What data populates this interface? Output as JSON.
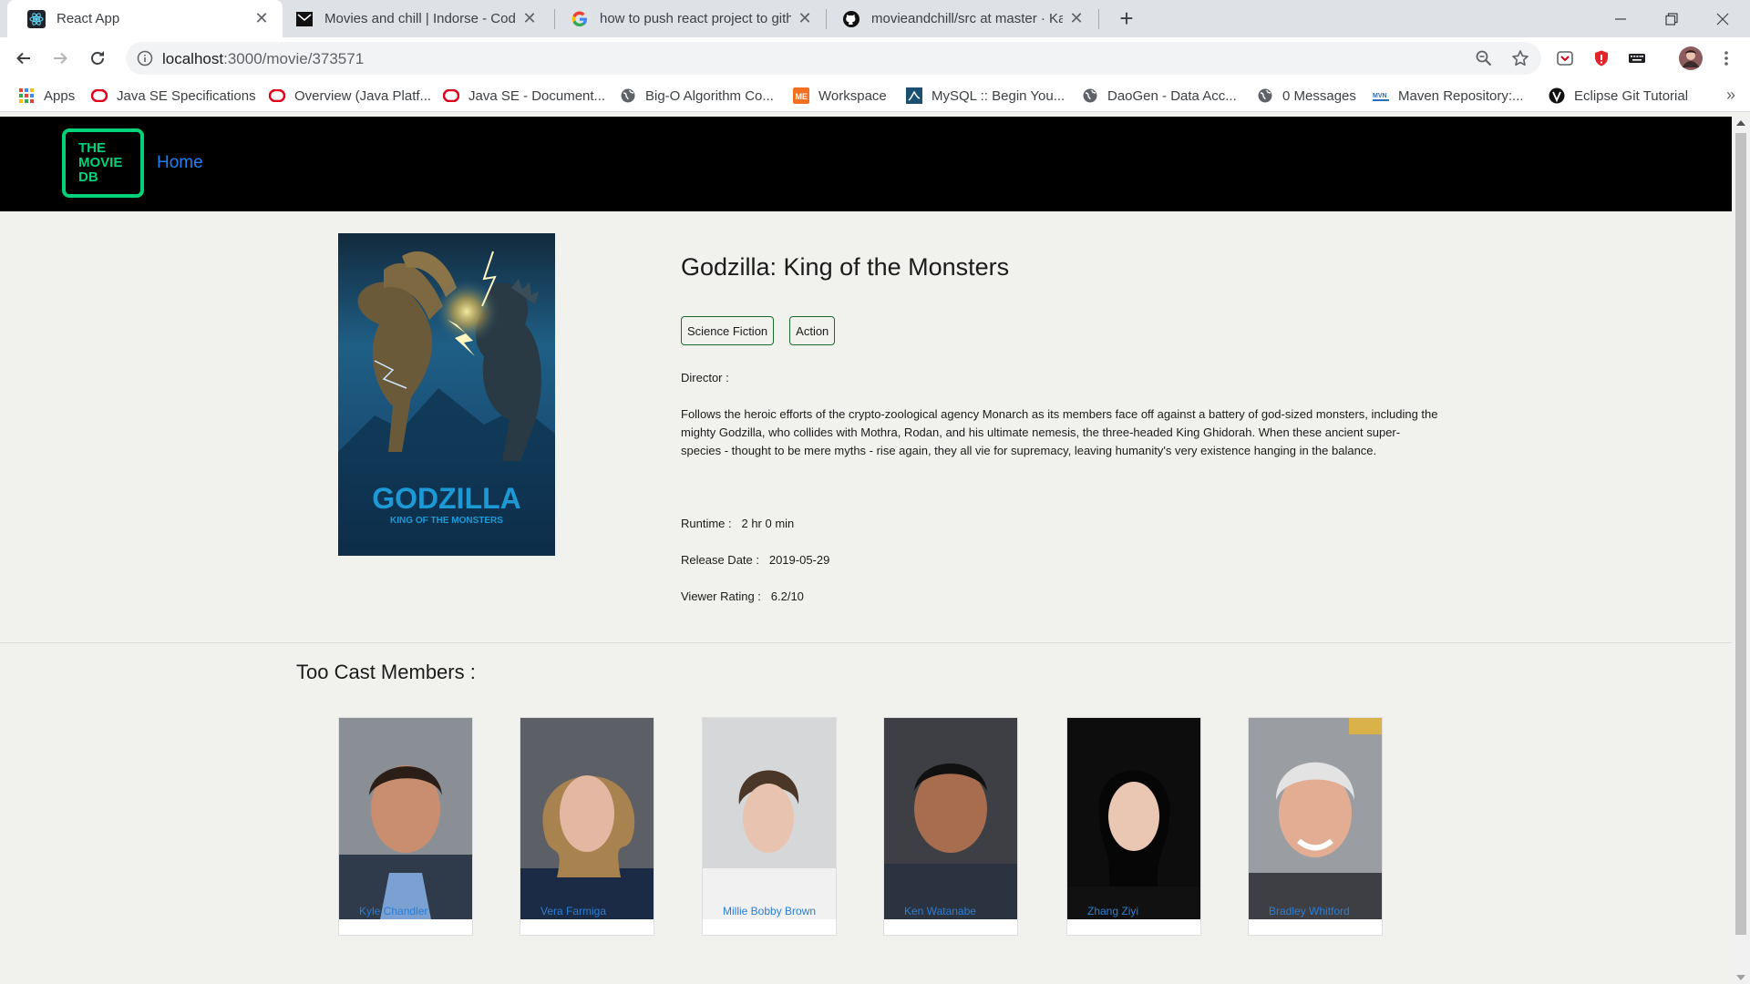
{
  "browser": {
    "tabs": [
      {
        "title": "React App",
        "icon": "react-icon",
        "active": true
      },
      {
        "title": "Movies and chill | Indorse - Codir",
        "icon": "indorse-icon",
        "active": false
      },
      {
        "title": "how to push react project to gith",
        "icon": "google-icon",
        "active": false
      },
      {
        "title": "movieandchill/src at master · Kat",
        "icon": "github-icon",
        "active": false
      }
    ],
    "address": {
      "host": "localhost",
      "path": ":3000/movie/373571"
    },
    "bookmarks": [
      {
        "label": "Apps",
        "icon": "apps-grid-icon"
      },
      {
        "label": "Java SE Specifications",
        "icon": "oracle-icon"
      },
      {
        "label": "Overview (Java Platf...",
        "icon": "oracle-icon"
      },
      {
        "label": "Java SE - Document...",
        "icon": "oracle-icon"
      },
      {
        "label": "Big-O Algorithm Co...",
        "icon": "globe-icon"
      },
      {
        "label": "Workspace",
        "icon": "workspace-icon"
      },
      {
        "label": "MySQL :: Begin You...",
        "icon": "mysql-icon"
      },
      {
        "label": "DaoGen - Data Acc...",
        "icon": "globe-icon"
      },
      {
        "label": "0 Messages",
        "icon": "globe-icon"
      },
      {
        "label": "Maven Repository:...",
        "icon": "maven-icon"
      },
      {
        "label": "Eclipse Git Tutorial",
        "icon": "vogella-icon"
      }
    ],
    "colors": {
      "tabstrip": "#dee1e6",
      "toolbar": "#ffffff"
    }
  },
  "site": {
    "logo": {
      "line1": "THE",
      "line2": "MOVIE",
      "line3": "DB"
    },
    "nav_home": "Home",
    "colors": {
      "logo": "#01d277",
      "link": "#1e80f0",
      "nav_bg": "#000000"
    }
  },
  "movie": {
    "title": "Godzilla: King of the Monsters",
    "poster_title": "GODZILLA",
    "poster_subtitle": "KING OF THE MONSTERS",
    "genres": [
      "Science Fiction",
      "Action"
    ],
    "director_label": "Director :",
    "director_value": "",
    "overview": "Follows the heroic efforts of the crypto-zoological agency Monarch as its members face off against a battery of god-sized monsters, including the mighty Godzilla, who collides with Mothra, Rodan, and his ultimate nemesis, the three-headed King Ghidorah. When these ancient super-species - thought to be mere myths - rise again, they all vie for supremacy, leaving humanity's very existence hanging in the balance.",
    "runtime_label": "Runtime :",
    "runtime_value": "2 hr 0 min",
    "release_label": "Release Date :",
    "release_value": "2019-05-29",
    "rating_label": "Viewer Rating :",
    "rating_value": "6.2/10"
  },
  "cast": {
    "heading": "Too Cast Members :",
    "members": [
      {
        "name": "Kyle Chandler"
      },
      {
        "name": "Vera Farmiga"
      },
      {
        "name": "Millie Bobby Brown"
      },
      {
        "name": "Ken Watanabe"
      },
      {
        "name": "Zhang Ziyi"
      },
      {
        "name": "Bradley Whitford"
      }
    ]
  }
}
